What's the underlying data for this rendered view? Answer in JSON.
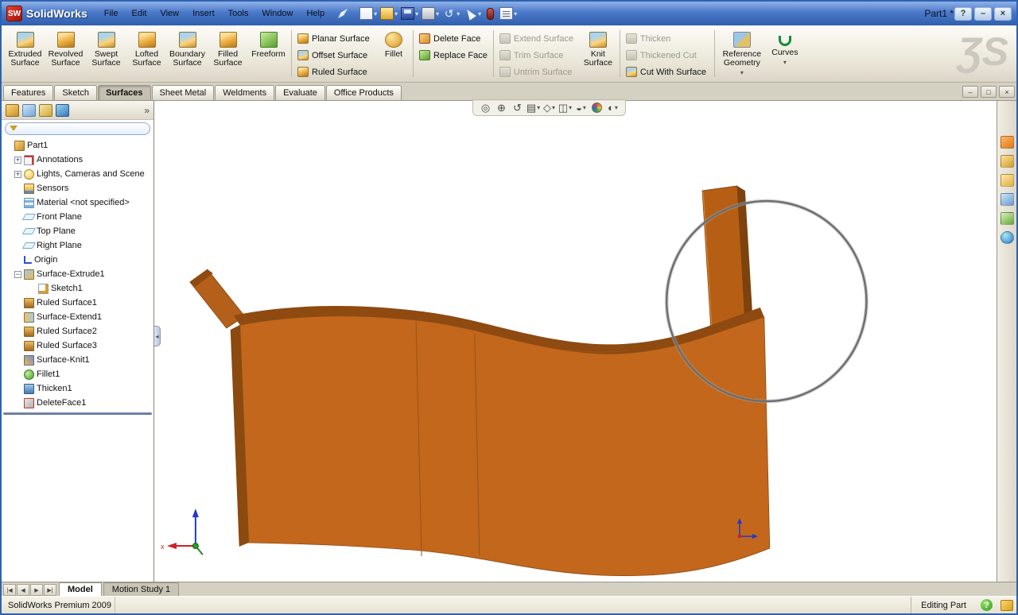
{
  "window": {
    "app_name": "SolidWorks",
    "title": "Part1 *"
  },
  "menu": [
    "File",
    "Edit",
    "View",
    "Insert",
    "Tools",
    "Window",
    "Help"
  ],
  "glyphs": {
    "undo": "↺",
    "caret": "▾",
    "chevron": "»",
    "help": "?",
    "minimize": "–",
    "restore": "□",
    "close": "×",
    "watermark": "ƷS",
    "question": "?",
    "splitter": "◂"
  },
  "command_tabs": [
    {
      "label": "Features"
    },
    {
      "label": "Sketch"
    },
    {
      "label": "Surfaces"
    },
    {
      "label": "Sheet Metal"
    },
    {
      "label": "Weldments"
    },
    {
      "label": "Evaluate"
    },
    {
      "label": "Office Products"
    }
  ],
  "ribbon": {
    "large": [
      "Extruded Surface",
      "Revolved Surface",
      "Swept Surface",
      "Lofted Surface",
      "Boundary Surface",
      "Filled Surface",
      "Freeform"
    ],
    "col1": [
      "Planar Surface",
      "Offset Surface",
      "Ruled Surface"
    ],
    "fillet": "Fillet",
    "col2": [
      "Delete Face",
      "Replace Face"
    ],
    "col3": [
      "Extend Surface",
      "Trim Surface",
      "Untrim Surface"
    ],
    "knit": "Knit Surface",
    "col4": [
      "Thicken",
      "Thickened Cut",
      "Cut With Surface"
    ],
    "reference": "Reference Geometry",
    "curves": "Curves"
  },
  "view_toolbar": [
    {
      "name": "zoom-fit",
      "glyph": "◎"
    },
    {
      "name": "zoom-to-area",
      "glyph": "⊕"
    },
    {
      "name": "previous-view",
      "glyph": "↺"
    },
    {
      "name": "section-view",
      "glyph": "▤",
      "caret": "▾"
    },
    {
      "name": "view-orientation",
      "glyph": "◇",
      "caret": "▾"
    },
    {
      "name": "display-style",
      "glyph": "◫",
      "caret": "▾"
    },
    {
      "name": "hide-show-items",
      "glyph": "◒",
      "caret": "▾"
    },
    {
      "name": "apply-scene",
      "glyph": ""
    },
    {
      "name": "view-settings",
      "glyph": "◐",
      "caret": "▾"
    }
  ],
  "tree": {
    "items": [
      {
        "label": "Part1",
        "expander": "",
        "level": 0
      },
      {
        "label": "Annotations",
        "expander": "+",
        "level": 1
      },
      {
        "label": "Lights, Cameras and Scene",
        "expander": "+",
        "level": 1
      },
      {
        "label": "Sensors",
        "expander": "",
        "level": 1
      },
      {
        "label": "Material <not specified>",
        "expander": "",
        "level": 1
      },
      {
        "label": "Front Plane",
        "expander": "",
        "level": 1
      },
      {
        "label": "Top Plane",
        "expander": "",
        "level": 1
      },
      {
        "label": "Right Plane",
        "expander": "",
        "level": 1
      },
      {
        "label": "Origin",
        "expander": "",
        "level": 1
      },
      {
        "label": "Surface-Extrude1",
        "expander": "−",
        "level": 1
      },
      {
        "label": "Sketch1",
        "expander": "",
        "level": 2
      },
      {
        "label": "Ruled Surface1",
        "expander": "",
        "level": 1
      },
      {
        "label": "Surface-Extend1",
        "expander": "",
        "level": 1
      },
      {
        "label": "Ruled Surface2",
        "expander": "",
        "level": 1
      },
      {
        "label": "Ruled Surface3",
        "expander": "",
        "level": 1
      },
      {
        "label": "Surface-Knit1",
        "expander": "",
        "level": 1
      },
      {
        "label": "Fillet1",
        "expander": "",
        "level": 1
      },
      {
        "label": "Thicken1",
        "expander": "",
        "level": 1
      },
      {
        "label": "DeleteFace1",
        "expander": "",
        "level": 1
      }
    ]
  },
  "bottom_tabs": {
    "nav": [
      "|◀",
      "◀",
      "▶",
      "▶|"
    ],
    "tabs": [
      "Model",
      "Motion Study 1"
    ]
  },
  "status_bar": {
    "product": "SolidWorks Premium 2009",
    "mode": "Editing Part"
  },
  "colors": {
    "titlebar": "#3b6cc0",
    "model_face": "#c2671c",
    "model_top": "#8e4a10",
    "model_side": "#7d420e",
    "sketch_ring": "#6e6e6e"
  }
}
